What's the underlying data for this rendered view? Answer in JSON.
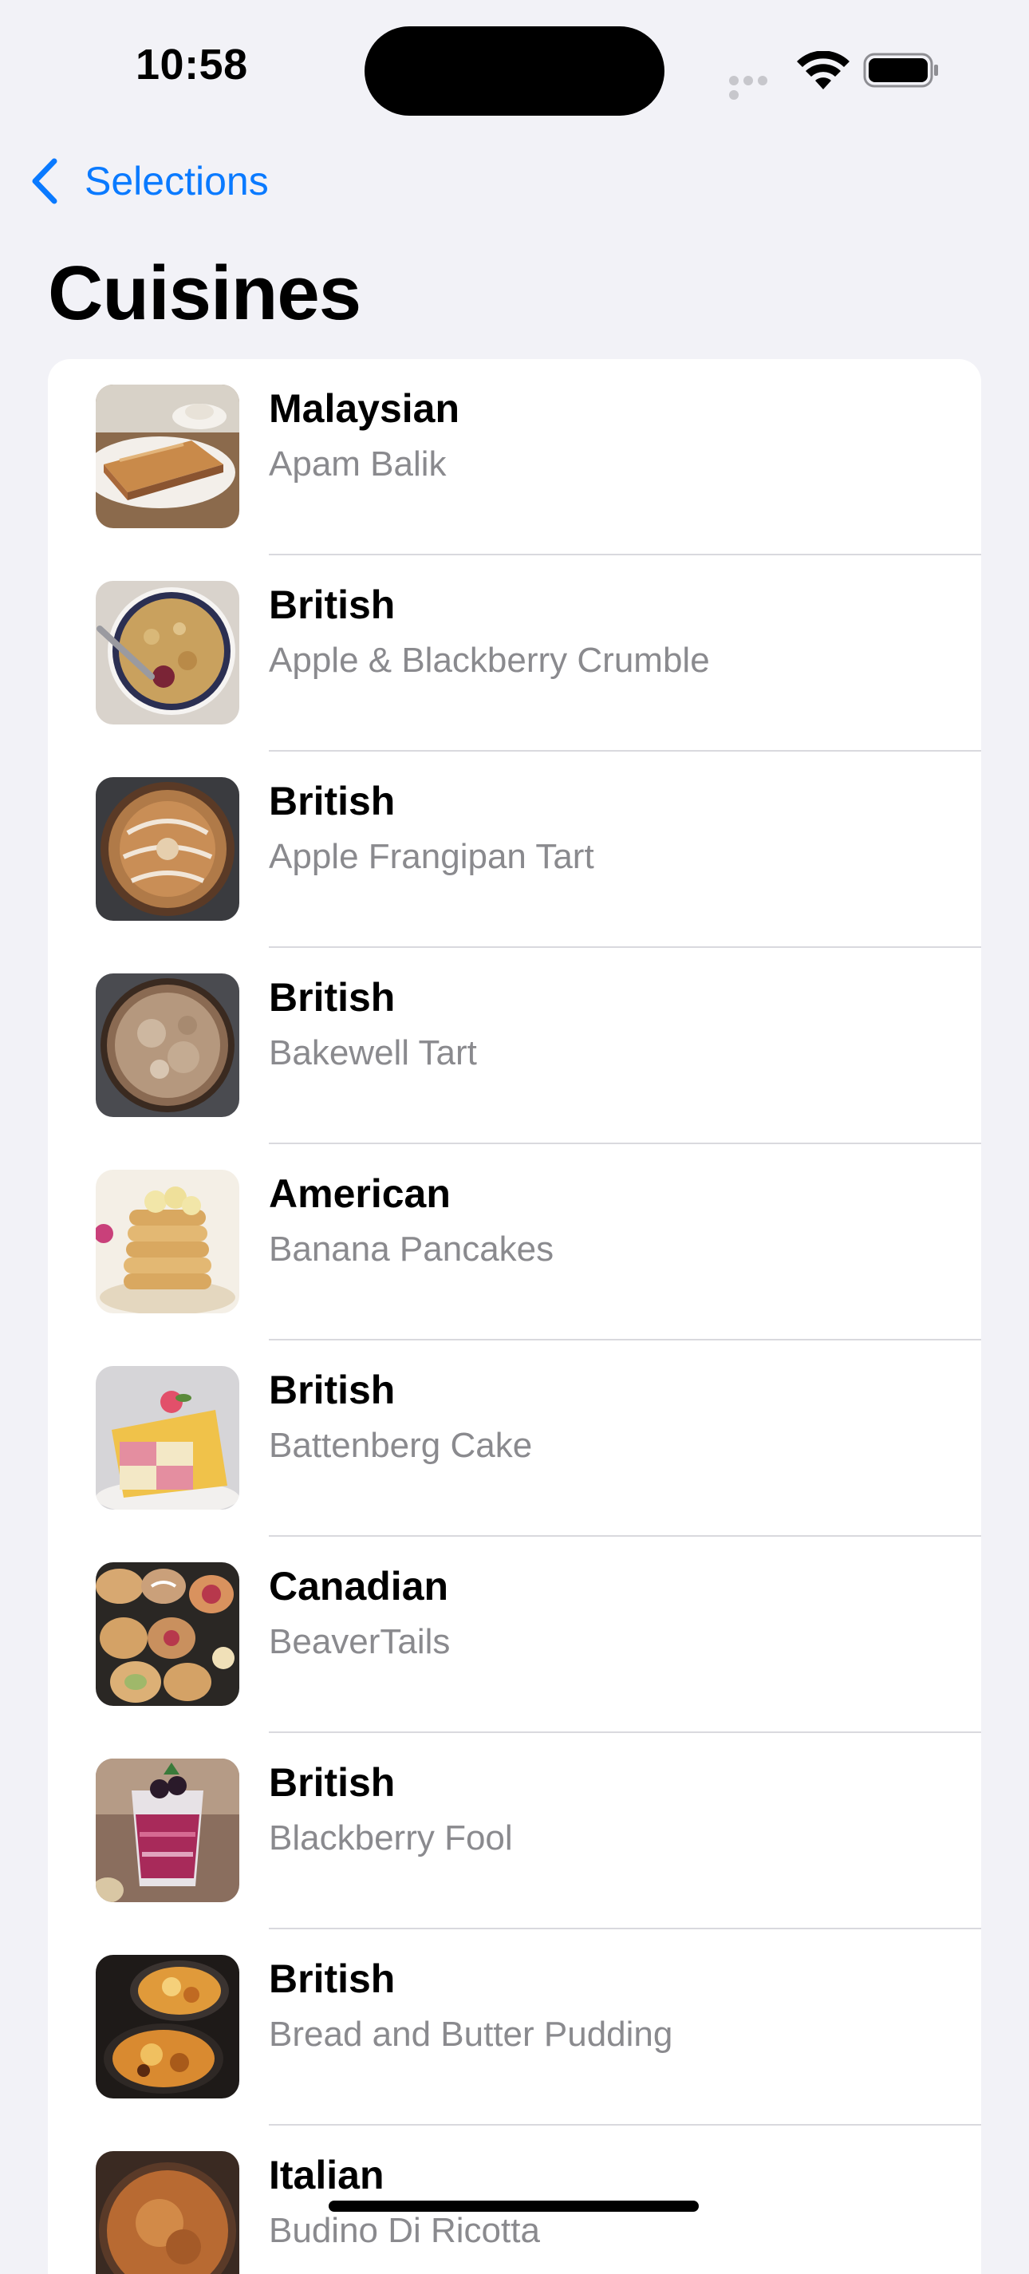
{
  "status_bar": {
    "time": "10:58",
    "icons": [
      "cellular-signal-icon",
      "wifi-icon",
      "battery-icon"
    ]
  },
  "nav": {
    "back_label": "Selections",
    "back_icon": "chevron-left-icon"
  },
  "title": "Cuisines",
  "accent_color": "#0a7aff",
  "items": [
    {
      "cuisine": "Malaysian",
      "meal": "Apam Balik",
      "thumbnail": "apam-balik-photo"
    },
    {
      "cuisine": "British",
      "meal": "Apple & Blackberry Crumble",
      "thumbnail": "crumble-photo"
    },
    {
      "cuisine": "British",
      "meal": "Apple Frangipan Tart",
      "thumbnail": "frangipan-tart-photo"
    },
    {
      "cuisine": "British",
      "meal": "Bakewell Tart",
      "thumbnail": "bakewell-tart-photo"
    },
    {
      "cuisine": "American",
      "meal": "Banana Pancakes",
      "thumbnail": "banana-pancakes-photo"
    },
    {
      "cuisine": "British",
      "meal": "Battenberg Cake",
      "thumbnail": "battenberg-cake-photo"
    },
    {
      "cuisine": "Canadian",
      "meal": "BeaverTails",
      "thumbnail": "beavertails-photo"
    },
    {
      "cuisine": "British",
      "meal": "Blackberry Fool",
      "thumbnail": "blackberry-fool-photo"
    },
    {
      "cuisine": "British",
      "meal": "Bread and Butter Pudding",
      "thumbnail": "bread-butter-pudding-photo"
    },
    {
      "cuisine": "Italian",
      "meal": "Budino Di Ricotta",
      "thumbnail": "budino-di-ricotta-photo"
    }
  ]
}
